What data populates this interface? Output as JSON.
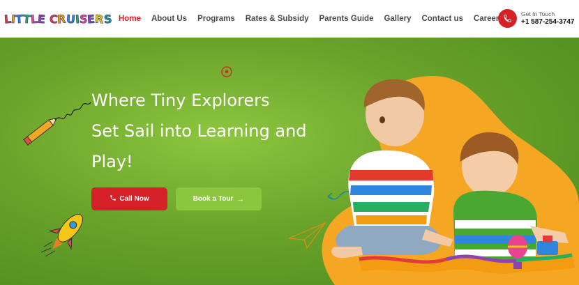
{
  "header": {
    "logo_letters": [
      "L",
      "i",
      "t",
      "t",
      "l",
      "e",
      " ",
      "C",
      "r",
      "u",
      "i",
      "s",
      "e",
      "r",
      "s"
    ],
    "logo_colors": [
      "#e23b3b",
      "#f39c12",
      "#2e86de",
      "#27ae60",
      "#e84393",
      "#8e44ad",
      "#ffffff",
      "#e23b3b",
      "#f39c12",
      "#2e86de",
      "#27ae60",
      "#e84393",
      "#8e44ad",
      "#f1c40f",
      "#16a085"
    ],
    "nav": [
      {
        "label": "Home"
      },
      {
        "label": "About Us"
      },
      {
        "label": "Programs"
      },
      {
        "label": "Rates & Subsidy"
      },
      {
        "label": "Parents Guide"
      },
      {
        "label": "Gallery"
      },
      {
        "label": "Contact us"
      },
      {
        "label": "Careers"
      }
    ],
    "contact_label": "Get In Touch",
    "contact_phone": "+1 587-254-3747"
  },
  "hero": {
    "headline_line1": "Where Tiny Explorers",
    "headline_line2": "Set Sail into Learning and",
    "headline_line3": "Play!",
    "call_button": "Call Now",
    "tour_button": "Book a Tour",
    "tour_arrow": "→"
  },
  "colors": {
    "brand_red": "#d62027",
    "brand_green": "#8cc63f",
    "blob_orange": "#f5a623"
  },
  "icons": [
    "phone-icon",
    "pencil-icon",
    "rocket-icon",
    "paper-plane-icon",
    "target-icon",
    "arrow-right-icon"
  ]
}
